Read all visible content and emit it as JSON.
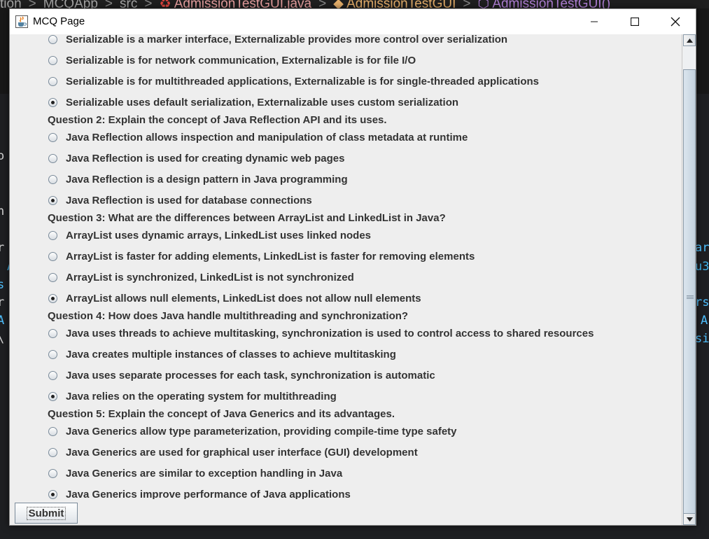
{
  "ide": {
    "breadcrumb": [
      "tion",
      "MCQApp",
      "src",
      "AdmissionTestGUI.java",
      "AdmissionTestGUI",
      "AdmissionTestGUI()"
    ],
    "left_code": [
      "o",
      "h",
      "r",
      "A",
      "s",
      "r",
      "A",
      "\\"
    ],
    "right_code": [
      "ar",
      "u3",
      "rs",
      "A",
      "si"
    ]
  },
  "window": {
    "title": "MCQ Page",
    "app_icon": "java-cup-icon"
  },
  "questions": [
    {
      "text": "",
      "options": [
        {
          "label": "Serializable is a marker interface, Externalizable provides more control over serialization",
          "selected": false
        },
        {
          "label": "Serializable is for network communication, Externalizable is for file I/O",
          "selected": false
        },
        {
          "label": "Serializable is for multithreaded applications, Externalizable is for single-threaded applications",
          "selected": false
        },
        {
          "label": "Serializable uses default serialization, Externalizable uses custom serialization",
          "selected": true
        }
      ]
    },
    {
      "text": "Question 2: Explain the concept of Java Reflection API and its uses.",
      "options": [
        {
          "label": "Java Reflection allows inspection and manipulation of class metadata at runtime",
          "selected": false
        },
        {
          "label": "Java Reflection is used for creating dynamic web pages",
          "selected": false
        },
        {
          "label": "Java Reflection is a design pattern in Java programming",
          "selected": false
        },
        {
          "label": "Java Reflection is used for database connections",
          "selected": true
        }
      ]
    },
    {
      "text": "Question 3: What are the differences between ArrayList and LinkedList in Java?",
      "options": [
        {
          "label": "ArrayList uses dynamic arrays, LinkedList uses linked nodes",
          "selected": false
        },
        {
          "label": "ArrayList is faster for adding elements, LinkedList is faster for removing elements",
          "selected": false
        },
        {
          "label": "ArrayList is synchronized, LinkedList is not synchronized",
          "selected": false
        },
        {
          "label": "ArrayList allows null elements, LinkedList does not allow null elements",
          "selected": true
        }
      ]
    },
    {
      "text": "Question 4: How does Java handle multithreading and synchronization?",
      "options": [
        {
          "label": "Java uses threads to achieve multitasking, synchronization is used to control access to shared resources",
          "selected": false
        },
        {
          "label": "Java creates multiple instances of classes to achieve multitasking",
          "selected": false
        },
        {
          "label": "Java uses separate processes for each task, synchronization is automatic",
          "selected": false
        },
        {
          "label": "Java relies on the operating system for multithreading",
          "selected": true
        }
      ]
    },
    {
      "text": "Question 5: Explain the concept of Java Generics and its advantages.",
      "options": [
        {
          "label": "Java Generics allow type parameterization, providing compile-time type safety",
          "selected": false
        },
        {
          "label": "Java Generics are used for graphical user interface (GUI) development",
          "selected": false
        },
        {
          "label": "Java Generics are similar to exception handling in Java",
          "selected": false
        },
        {
          "label": "Java Generics improve performance of Java applications",
          "selected": true
        }
      ]
    }
  ],
  "submit_label": "Submit"
}
